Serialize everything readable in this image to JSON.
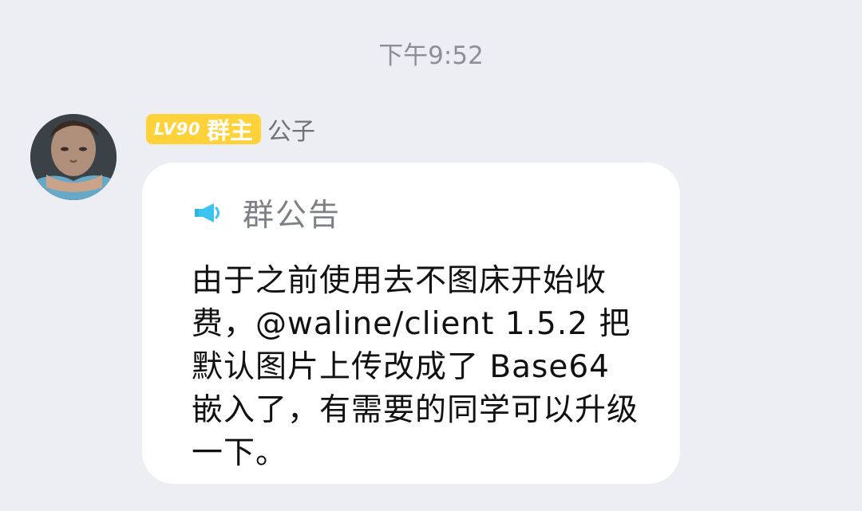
{
  "timestamp": "下午9:52",
  "sender": {
    "level_badge": "LV90",
    "role_badge": "群主",
    "name": "公子",
    "avatar_icon": "user-avatar"
  },
  "announcement": {
    "icon": "megaphone-icon",
    "title": "群公告",
    "body": "由于之前使用去不图床开始收费，@waline/client 1.5.2 把默认图片上传改成了 Base64 嵌入了，有需要的同学可以升级一下。"
  },
  "colors": {
    "background": "#eceef3",
    "bubble": "#ffffff",
    "badge": "#ffd23a",
    "icon_accent": "#3cc3f0"
  }
}
